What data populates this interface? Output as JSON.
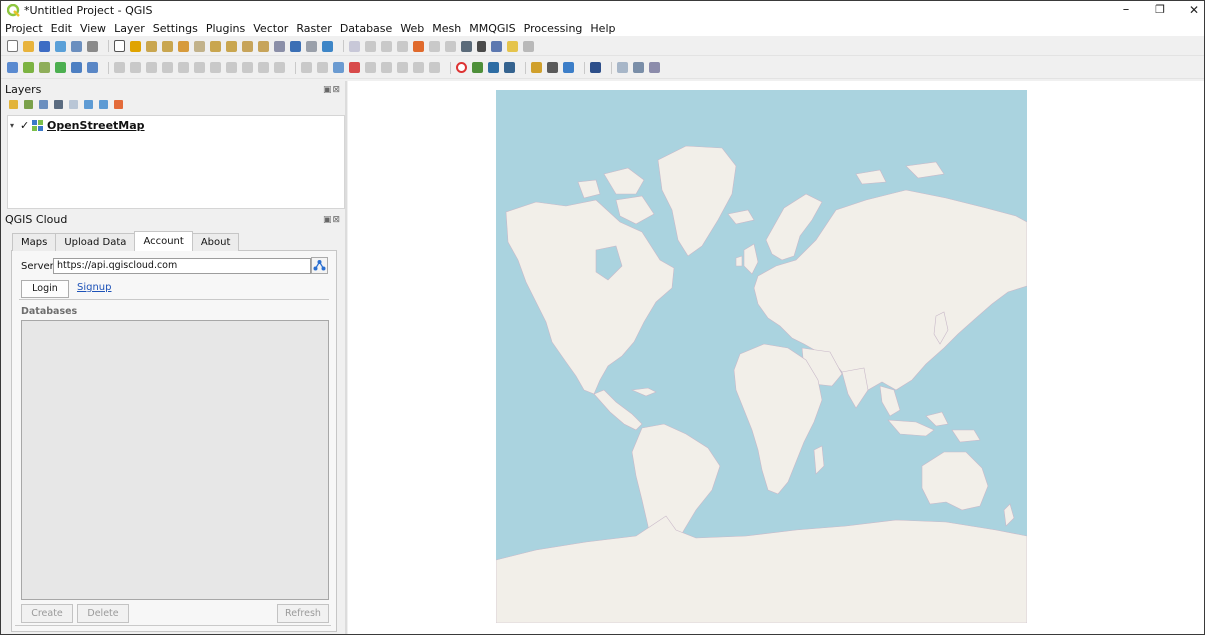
{
  "window": {
    "title": "*Untitled Project - QGIS",
    "minimize": "–",
    "maximize": "❐",
    "close": "✕"
  },
  "menu": [
    "Project",
    "Edit",
    "View",
    "Layer",
    "Settings",
    "Plugins",
    "Vector",
    "Raster",
    "Database",
    "Web",
    "Mesh",
    "MMQGIS",
    "Processing",
    "Help"
  ],
  "layers_panel": {
    "title": "Layers",
    "controls": "▣⊠",
    "layers": [
      {
        "name": "OpenStreetMap",
        "checked": true,
        "check_glyph": "✓",
        "expander": "▾"
      }
    ]
  },
  "cloud_panel": {
    "title": "QGIS Cloud",
    "controls": "▣⊠",
    "tabs": [
      "Maps",
      "Upload Data",
      "Account",
      "About"
    ],
    "active_tab": "Account",
    "server_label": "Server:",
    "server_value": "https://api.qgiscloud.com",
    "login_label": "Login",
    "signup_label": "Signup",
    "databases_label": "Databases",
    "create_label": "Create",
    "delete_label": "Delete",
    "refresh_label": "Refresh"
  },
  "colors": {
    "ocean": "#aad3df",
    "land": "#f2efe9",
    "border": "#c9b9c9",
    "link": "#1d52b8",
    "qgis_green": "#8dc63f"
  }
}
